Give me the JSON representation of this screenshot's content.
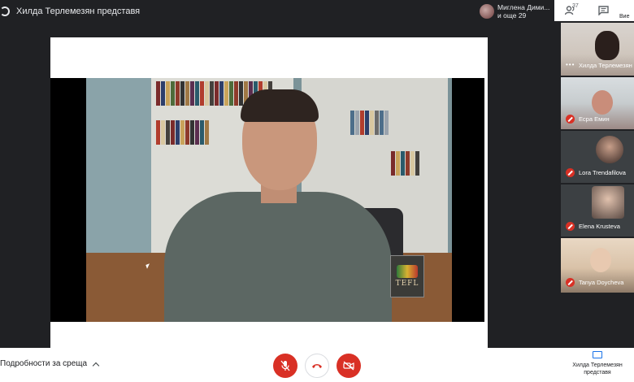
{
  "header": {
    "presenting_title": "Хилда Терлемезян представя"
  },
  "viewer": {
    "line1": "Миглена Дими...",
    "line2": "и още 29"
  },
  "toolbar": {
    "people_count": "37",
    "you_label": "Вие"
  },
  "participants": [
    {
      "name": "Хилда Терлемезян",
      "muted": false
    },
    {
      "name": "Есра Емин",
      "muted": true
    },
    {
      "name": "Lora Trendafilova",
      "muted": true
    },
    {
      "name": "Elena Krusteva",
      "muted": true
    },
    {
      "name": "Tanya Doycheva",
      "muted": true
    }
  ],
  "presentation": {
    "logo_text": "TEFL"
  },
  "bottom": {
    "details_label": "Подробности за среща",
    "present_label_1": "Хилда Терлемезян",
    "present_label_2": "представя"
  },
  "colors": {
    "danger": "#d93025",
    "accent": "#1a73e8",
    "background": "#202124"
  },
  "icons": [
    "present-icon",
    "people-icon",
    "chat-icon",
    "mic-off-icon",
    "hangup-icon",
    "camera-off-icon",
    "chevron-up-icon",
    "present-screen-icon"
  ]
}
